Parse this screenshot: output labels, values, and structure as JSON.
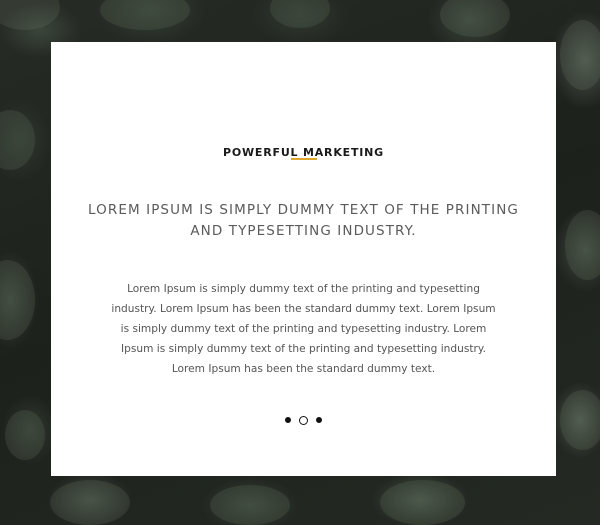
{
  "card": {
    "title": "POWERFUL MARKETING",
    "headline": "LOREM IPSUM IS SIMPLY DUMMY TEXT OF THE PRINTING AND TYPESETTING INDUSTRY.",
    "body": "Lorem Ipsum is simply dummy text of the printing and typesetting industry. Lorem Ipsum has been the standard dummy text. Lorem Ipsum is simply dummy text of the printing and typesetting industry. Lorem Ipsum is simply dummy text of the printing and typesetting industry. Lorem Ipsum has been the standard dummy text."
  },
  "slider": {
    "slide_count": 3,
    "active_index": 1
  },
  "colors": {
    "accent": "#e0a72e",
    "background": "#1f231e",
    "card": "#ffffff"
  }
}
